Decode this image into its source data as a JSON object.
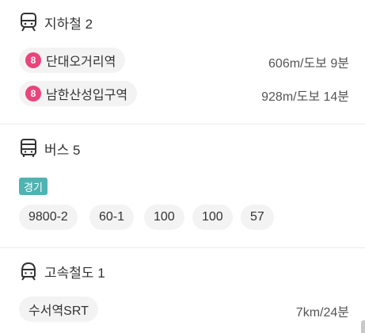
{
  "subway": {
    "title": "지하철",
    "count": "2",
    "icon": "subway-icon",
    "stations": [
      {
        "line": "8",
        "line_color": "#e8457b",
        "name": "단대오거리역",
        "distance": "606m/도보 9분"
      },
      {
        "line": "8",
        "line_color": "#e8457b",
        "name": "남한산성입구역",
        "distance": "928m/도보 14분"
      }
    ]
  },
  "bus": {
    "title": "버스",
    "count": "5",
    "icon": "bus-icon",
    "region": "경기",
    "region_color": "#4fb3b1",
    "routes": [
      "9800-2",
      "60-1",
      "100",
      "100",
      "57"
    ]
  },
  "express_rail": {
    "title": "고속철도",
    "count": "1",
    "icon": "train-icon",
    "stations": [
      {
        "name": "수서역SRT",
        "distance": "7km/24분"
      }
    ]
  }
}
